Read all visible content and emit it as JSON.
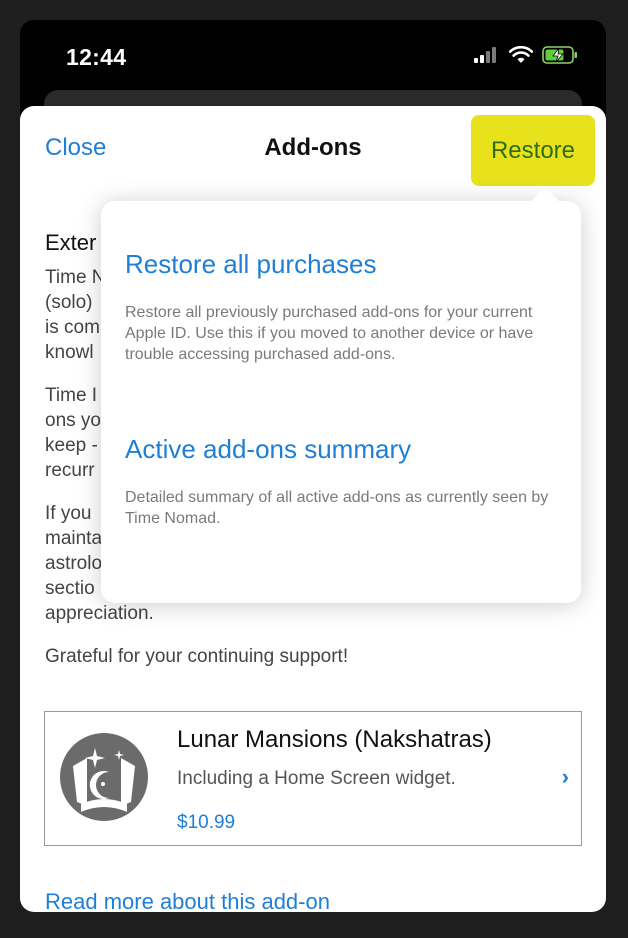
{
  "status": {
    "time": "12:44"
  },
  "nav": {
    "close_label": "Close",
    "title": "Add-ons",
    "restore_label": "Restore"
  },
  "content": {
    "heading": "Exter",
    "paragraphs": [
      "Time N\n(solo)\nis com\nknowl",
      "Time I\nons yo\nkeep -\nrecurr",
      "If you\nmainta\nastrolo\nsectio",
      "appreciation.",
      "Grateful for your continuing support!"
    ]
  },
  "popover": {
    "items": [
      {
        "title": "Restore all purchases",
        "description": "Restore all previously purchased add-ons for your current Apple ID. Use this if you moved to another device or have trouble accessing purchased add-ons."
      },
      {
        "title": "Active add-ons summary",
        "description": "Detailed summary of all active add-ons as currently seen by Time Nomad."
      }
    ]
  },
  "addon": {
    "title": "Lunar Mansions (Nakshatras)",
    "subtitle": "Including a Home Screen widget.",
    "price": "$10.99",
    "icon": "moon-stars-icon",
    "chevron": "›"
  },
  "read_more": "Read more about this add-on",
  "colors": {
    "accent": "#1f7fd6",
    "highlight": "#e8e21c",
    "highlight_text": "#2f6d18"
  }
}
